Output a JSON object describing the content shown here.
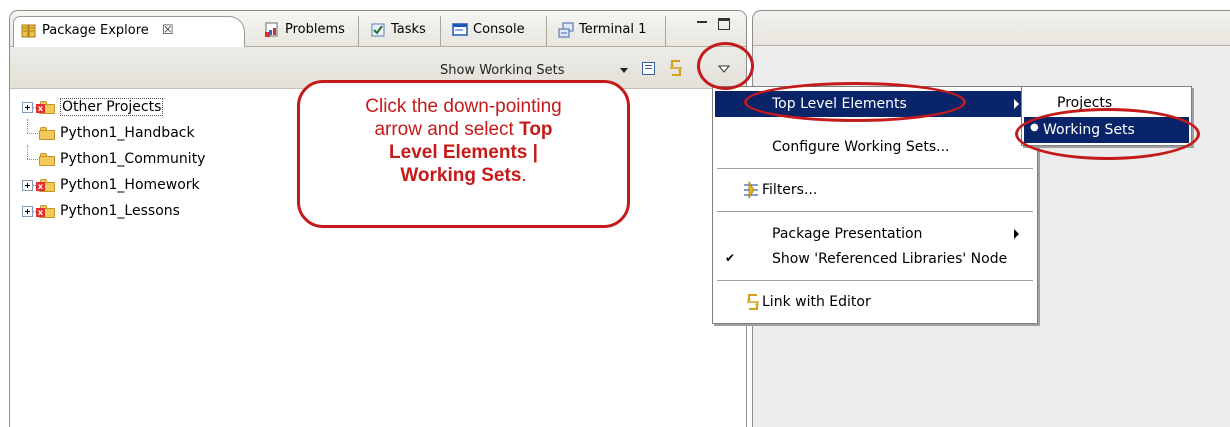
{
  "tabs": [
    {
      "label": "Package Explore",
      "close_glyph": "☒",
      "active": true,
      "icon": "package-explorer-icon"
    },
    {
      "label": "Problems",
      "active": false,
      "icon": "problems-icon"
    },
    {
      "label": "Tasks",
      "active": false,
      "icon": "tasks-icon"
    },
    {
      "label": "Console",
      "active": false,
      "icon": "console-icon"
    },
    {
      "label": "Terminal 1",
      "active": false,
      "icon": "terminal-icon"
    }
  ],
  "toolbar": {
    "show_label": "Show Working Sets",
    "icons": [
      "dropdown-arrow-icon",
      "collapse-all-icon",
      "link-with-editor-icon",
      "view-menu-icon"
    ]
  },
  "tree": [
    {
      "label": "Other Projects",
      "expandable": true,
      "error": true
    },
    {
      "label": "Python1_Handback",
      "expandable": false,
      "error": false
    },
    {
      "label": "Python1_Community",
      "expandable": false,
      "error": false
    },
    {
      "label": "Python1_Homework",
      "expandable": true,
      "error": true
    },
    {
      "label": "Python1_Lessons",
      "expandable": true,
      "error": true
    }
  ],
  "callout": {
    "line1": "Click the down-pointing",
    "line2_prefix": "arrow and select ",
    "line2_bold": "Top",
    "line3": "Level Elements |",
    "line4": "Working Sets",
    "line4_suffix": ".",
    "color": "#c41a1a"
  },
  "menu": {
    "items": [
      {
        "label": "Top Level Elements",
        "submenu": true,
        "selected": true
      },
      {
        "label": "Configure Working Sets...",
        "submenu": false
      },
      {
        "label": "Filters...",
        "icon": "filters-icon"
      },
      {
        "label": "Package Presentation",
        "submenu": true
      },
      {
        "label": "Show 'Referenced Libraries' Node",
        "checked": true,
        "check_glyph": "✔"
      },
      {
        "label": "Link with Editor",
        "icon": "link-with-editor-icon"
      }
    ]
  },
  "submenu": {
    "items": [
      {
        "label": "Projects",
        "selected": false
      },
      {
        "label": "Working Sets",
        "selected": true,
        "bullet": "●"
      }
    ]
  },
  "colors": {
    "menu_highlight": "#0a246a",
    "annotation_red": "#c41a1a"
  }
}
